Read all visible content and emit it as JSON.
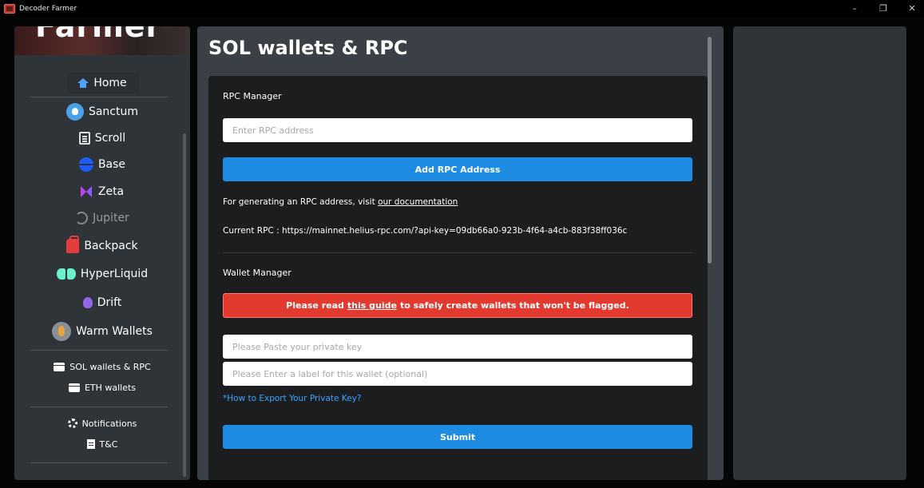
{
  "window": {
    "title": "Decoder Farmer",
    "minimize": "–",
    "restore": "❐",
    "close": "✕"
  },
  "sidebar": {
    "banner_text": "Farmer",
    "items": [
      {
        "label": "Home",
        "icon": "home-icon"
      },
      {
        "label": "Sanctum",
        "icon": "sanctum-icon"
      },
      {
        "label": "Scroll",
        "icon": "scroll-icon"
      },
      {
        "label": "Base",
        "icon": "base-icon"
      },
      {
        "label": "Zeta",
        "icon": "zeta-icon"
      },
      {
        "label": "Jupiter",
        "icon": "jupiter-icon"
      },
      {
        "label": "Backpack",
        "icon": "backpack-icon"
      },
      {
        "label": "HyperLiquid",
        "icon": "hyperliquid-icon"
      },
      {
        "label": "Drift",
        "icon": "drift-icon"
      },
      {
        "label": "Warm Wallets",
        "icon": "warm-wallets-icon"
      }
    ],
    "wallet_items": [
      {
        "label": "SOL wallets & RPC",
        "icon": "wallet-icon"
      },
      {
        "label": "ETH wallets",
        "icon": "wallet-icon"
      }
    ],
    "other_items": [
      {
        "label": "Notifications",
        "icon": "gear-icon"
      },
      {
        "label": "T&C",
        "icon": "document-icon"
      }
    ]
  },
  "main": {
    "title": "SOL wallets & RPC",
    "rpc": {
      "section_label": "RPC Manager",
      "input_placeholder": "Enter RPC address",
      "add_button": "Add RPC Address",
      "doc_text_prefix": "For generating an RPC address, visit ",
      "doc_link": "our documentation",
      "current_rpc": "Current RPC : https://mainnet.helius-rpc.com/?api-key=09db66a0-923b-4f64-a4cb-883f38ff036c"
    },
    "wallet": {
      "section_label": "Wallet Manager",
      "alert_prefix": "Please read",
      "alert_link": "this guide",
      "alert_suffix": "to safely create wallets that won't be flagged.",
      "private_key_placeholder": "Please Paste your private key",
      "label_placeholder": "Please Enter a label for this wallet (optional)",
      "export_link": "*How to Export Your Private Key?",
      "submit_button": "Submit"
    }
  },
  "colors": {
    "accent": "#1e8ce3",
    "alert": "#e33a2f",
    "link": "#3aa3ff"
  }
}
